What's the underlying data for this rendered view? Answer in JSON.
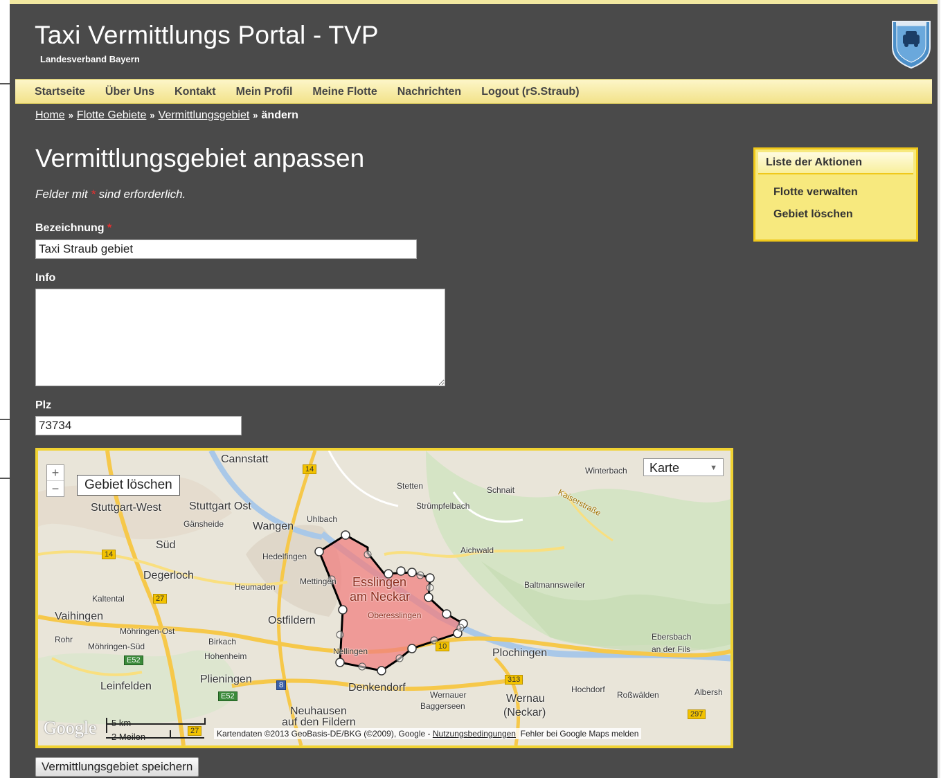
{
  "header": {
    "title": "Taxi Vermittlungs Portal - TVP",
    "subtitle": "Landesverband Bayern"
  },
  "menu": [
    "Startseite",
    "Über Uns",
    "Kontakt",
    "Mein Profil",
    "Meine Flotte",
    "Nachrichten",
    "Logout (rS.Straub)"
  ],
  "breadcrumb": {
    "home": "Home",
    "flotte_gebiete": "Flotte Gebiete",
    "vermittlungsgebiet": "Vermittlungsgebiet",
    "current": "ändern",
    "separator": "»"
  },
  "page": {
    "title": "Vermittlungsgebiet anpassen",
    "required_note_prefix": "Felder mit ",
    "required_star": "*",
    "required_note_suffix": " sind erforderlich."
  },
  "form": {
    "bezeichnung_label": "Bezeichnung",
    "bezeichnung_value": "Taxi Straub gebiet",
    "info_label": "Info",
    "info_value": "",
    "plz_label": "Plz",
    "plz_value": "73734",
    "save_label": "Vermittlungsgebiet speichern"
  },
  "map": {
    "zoom_in": "+",
    "zoom_out": "−",
    "delete_area_label": "Gebiet löschen",
    "map_type": "Karte",
    "google_logo": "Google",
    "scale_km": "5 km",
    "scale_miles": "2 Meilen",
    "attribution": "Kartendaten ©2013 GeoBasis-DE/BKG (©2009), Google",
    "terms_link": "Nutzungsbedingungen",
    "report_link": "Fehler bei Google Maps melden",
    "places": {
      "cannstatt": "Cannstatt",
      "stuttgart_west": "Stuttgart-West",
      "stuttgart_ost": "Stuttgart Ost",
      "gaensheide": "Gänsheide",
      "wangen": "Wangen",
      "uhlbach": "Uhlbach",
      "stetten": "Stetten",
      "schnait": "Schnait",
      "struempfelbach": "Strümpfelbach",
      "kaiserstrasse": "Kaiserstraße",
      "winterbach": "Winterbach",
      "sued": "Süd",
      "hedelfingen": "Hedelfingen",
      "aichwald": "Aichwald",
      "degerloch": "Degerloch",
      "heumaden": "Heumaden",
      "mettingen": "Mettingen",
      "esslingen1": "Esslingen",
      "esslingen2": "am Neckar",
      "oberesslingen": "Oberesslingen",
      "baltmannsweiler": "Baltmannsweiler",
      "kaltental": "Kaltental",
      "vaihingen": "Vaihingen",
      "ostfildern": "Ostfildern",
      "moehringen_ost": "Möhringen-Ost",
      "rohr": "Rohr",
      "moehringen_sued": "Möhringen-Süd",
      "birkach": "Birkach",
      "hohenheim": "Hohenheim",
      "nellingen": "Nellingen",
      "plochingen": "Plochingen",
      "ebersbach1": "Ebersbach",
      "ebersbach2": "an der Fils",
      "leinfelden": "Leinfelden",
      "plieningen": "Plieningen",
      "denkendorf": "Denkendorf",
      "wernauer1": "Wernauer",
      "wernauer2": "Baggerseen",
      "wernau1": "Wernau",
      "wernau2": "(Neckar)",
      "hochdorf": "Hochdorf",
      "rosswaelden": "Roßwälden",
      "albersh": "Albersh",
      "neuhausen1": "Neuhausen",
      "neuhausen2": "auf den Fildern"
    },
    "roads": [
      "14",
      "14",
      "27",
      "10",
      "E52",
      "8",
      "E52",
      "313",
      "297",
      "27"
    ]
  },
  "sidebar": {
    "title": "Liste der Aktionen",
    "items": [
      "Flotte verwalten",
      "Gebiet löschen"
    ]
  },
  "colors": {
    "background": "#4a4a4a",
    "menu": "#f2e28a",
    "accent": "#f0c81a",
    "polygon_fill": "#f08080",
    "required": "#e53030"
  }
}
